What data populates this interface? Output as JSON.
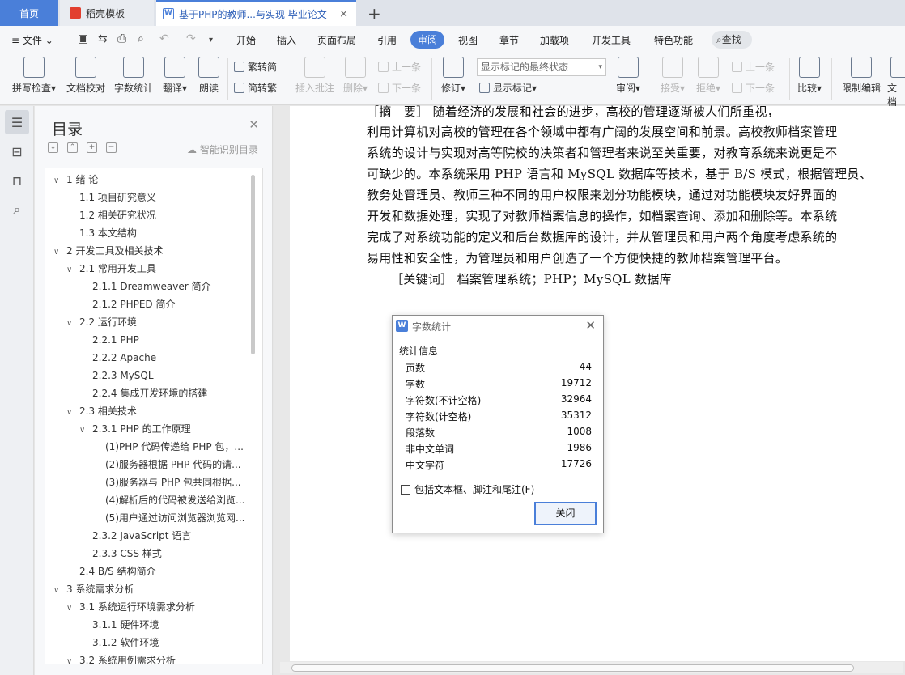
{
  "tabs": {
    "home": "首页",
    "template": "稻壳模板",
    "doc": "基于PHP的教师...与实现 毕业论文",
    "doc_close": "×",
    "new_tab": "+"
  },
  "menu": {
    "file": "文件",
    "items": [
      "开始",
      "插入",
      "页面布局",
      "引用",
      "审阅",
      "视图",
      "章节",
      "加载项",
      "开发工具",
      "特色功能"
    ],
    "search": "查找"
  },
  "ribbon": {
    "spell_check": "拼写检查",
    "doc_proof": "文档校对",
    "word_count": "字数统计",
    "translate": "翻译",
    "read_aloud": "朗读",
    "trad_to_simp": "繁转简",
    "simp_to_trad": "简转繁",
    "insert_comment": "插入批注",
    "delete": "删除",
    "prev_item": "上一条",
    "next_item": "下一条",
    "revise": "修订",
    "markup_state": "显示标记的最终状态",
    "show_markup": "显示标记",
    "review": "审阅",
    "accept": "接受",
    "reject": "拒绝",
    "prev_item2": "上一条",
    "next_item2": "下一条",
    "compare": "比较",
    "restrict_edit": "限制编辑",
    "doc_cut": "文档"
  },
  "toc": {
    "title": "目录",
    "smart": "智能识别目录",
    "items": [
      {
        "text": "1  绪  论",
        "level": 0,
        "arrow": "∨"
      },
      {
        "text": "1.1  项目研究意义",
        "level": 1,
        "arrow": ""
      },
      {
        "text": "1.2  相关研究状况",
        "level": 1,
        "arrow": ""
      },
      {
        "text": "1.3  本文结构",
        "level": 1,
        "arrow": ""
      },
      {
        "text": "2  开发工具及相关技术",
        "level": 0,
        "arrow": "∨"
      },
      {
        "text": "2.1  常用开发工具",
        "level": 1,
        "arrow": "∨"
      },
      {
        "text": "2.1.1  Dreamweaver 简介",
        "level": 2,
        "arrow": ""
      },
      {
        "text": "2.1.2  PHPED 简介",
        "level": 2,
        "arrow": ""
      },
      {
        "text": "2.2  运行环境",
        "level": 1,
        "arrow": "∨"
      },
      {
        "text": "2.2.1  PHP",
        "level": 2,
        "arrow": ""
      },
      {
        "text": "2.2.2  Apache",
        "level": 2,
        "arrow": ""
      },
      {
        "text": "2.2.3  MySQL",
        "level": 2,
        "arrow": ""
      },
      {
        "text": "2.2.4  集成开发环境的搭建",
        "level": 2,
        "arrow": ""
      },
      {
        "text": "2.3  相关技术",
        "level": 1,
        "arrow": "∨"
      },
      {
        "text": "2.3.1  PHP 的工作原理",
        "level": 2,
        "arrow": "∨"
      },
      {
        "text": "(1)PHP 代码传递给 PHP 包，...",
        "level": 3,
        "arrow": ""
      },
      {
        "text": "(2)服务器根据 PHP 代码的请...",
        "level": 3,
        "arrow": ""
      },
      {
        "text": "(3)服务器与 PHP 包共同根据...",
        "level": 3,
        "arrow": ""
      },
      {
        "text": "(4)解析后的代码被发送给浏览...",
        "level": 3,
        "arrow": ""
      },
      {
        "text": "(5)用户通过访问浏览器浏览网...",
        "level": 3,
        "arrow": ""
      },
      {
        "text": "2.3.2  JavaScript 语言",
        "level": 2,
        "arrow": ""
      },
      {
        "text": "2.3.3  CSS 样式",
        "level": 2,
        "arrow": ""
      },
      {
        "text": "2.4  B/S 结构简介",
        "level": 1,
        "arrow": ""
      },
      {
        "text": "3  系统需求分析",
        "level": 0,
        "arrow": "∨"
      },
      {
        "text": "3.1  系统运行环境需求分析",
        "level": 1,
        "arrow": "∨"
      },
      {
        "text": "3.1.1  硬件环境",
        "level": 2,
        "arrow": ""
      },
      {
        "text": "3.1.2  软件环境",
        "level": 2,
        "arrow": ""
      },
      {
        "text": "3.2  系统用例需求分析",
        "level": 1,
        "arrow": "∨"
      }
    ]
  },
  "document": {
    "lines": [
      "［摘　要］ 随着经济的发展和社会的进步，高校的管理逐渐被人们所重视，",
      "利用计算机对高校的管理在各个领域中都有广阔的发展空间和前景。高校教师档案管理",
      "系统的设计与实现对高等院校的决策者和管理者来说至关重要，对教育系统来说更是不",
      "可缺少的。本系统采用 PHP 语言和 MySQL 数据库等技术，基于 B/S 模式，根据管理员、",
      "教务处管理员、教师三种不同的用户权限来划分功能模块，通过对功能模块友好界面的",
      "开发和数据处理，实现了对教师档案信息的操作，如档案查询、添加和删除等。本系统",
      "完成了对系统功能的定义和后台数据库的设计，并从管理员和用户两个角度考虑系统的",
      "易用性和安全性，为管理员和用户创造了一个方便快捷的教师档案管理平台。"
    ],
    "keywords": "［关键词］  档案管理系统；PHP；MySQL 数据库"
  },
  "dialog": {
    "title": "字数统计",
    "icon_letter": "W",
    "section": "统计信息",
    "rows": [
      {
        "label": "页数",
        "value": "44"
      },
      {
        "label": "字数",
        "value": "19712"
      },
      {
        "label": "字符数(不计空格)",
        "value": "32964"
      },
      {
        "label": "字符数(计空格)",
        "value": "35312"
      },
      {
        "label": "段落数",
        "value": "1008"
      },
      {
        "label": "非中文单词",
        "value": "1986"
      },
      {
        "label": "中文字符",
        "value": "17726"
      }
    ],
    "checkbox": "包括文本框、脚注和尾注(F)",
    "close_button": "关闭"
  },
  "colors": {
    "accent": "#4a7fd9",
    "template_icon": "#e23f2f"
  }
}
